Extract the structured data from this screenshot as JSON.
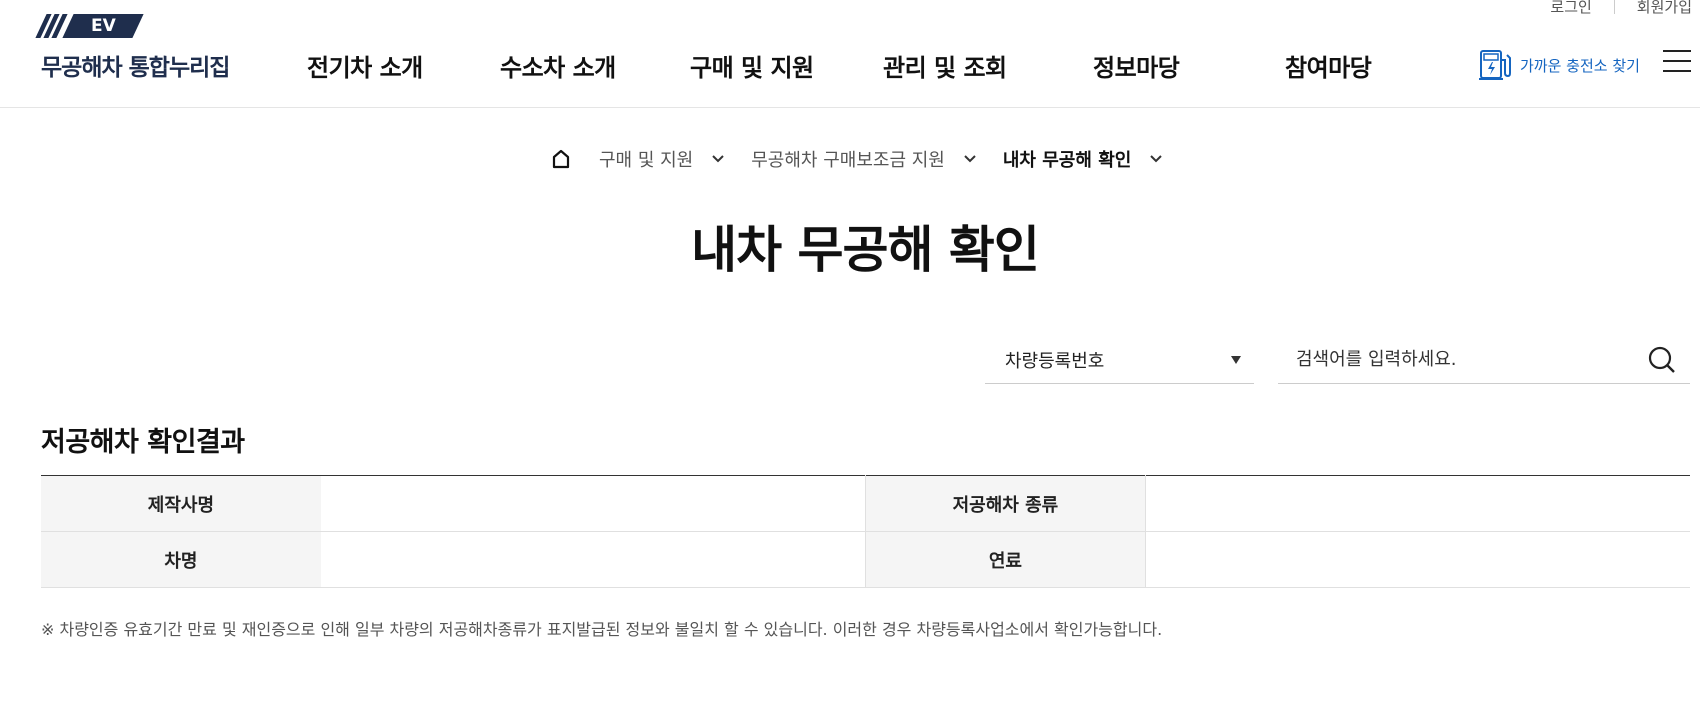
{
  "util": {
    "login": "로그인",
    "signup": "회원가입"
  },
  "logo": {
    "badge": "EV",
    "name": "무공해차 통합누리집"
  },
  "gnb": [
    "전기차 소개",
    "수소차 소개",
    "구매 및 지원",
    "관리 및 조회",
    "정보마당",
    "참여마당"
  ],
  "charger": {
    "label": "가까운 충전소 찾기"
  },
  "breadcrumb": {
    "level1": "구매 및 지원",
    "level2": "무공해차 구매보조금 지원",
    "current": "내차 무공해 확인"
  },
  "page_title": "내차 무공해 확인",
  "search": {
    "select_value": "차량등록번호",
    "placeholder": "검색어를 입력하세요."
  },
  "result": {
    "title": "저공해차 확인결과",
    "labels": {
      "maker": "제작사명",
      "type": "저공해차 종류",
      "model": "차명",
      "fuel": "연료"
    },
    "values": {
      "maker": "",
      "type": "",
      "model": "",
      "fuel": ""
    }
  },
  "notice": "※ 차량인증 유효기간 만료 및 재인증으로 인해 일부 차량의 저공해차종류가 표지발급된 정보와 불일치 할 수 있습니다. 이러한 경우 차량등록사업소에서 확인가능합니다.",
  "colors": {
    "brand": "#1f2e4d",
    "accent": "#1565c0"
  }
}
